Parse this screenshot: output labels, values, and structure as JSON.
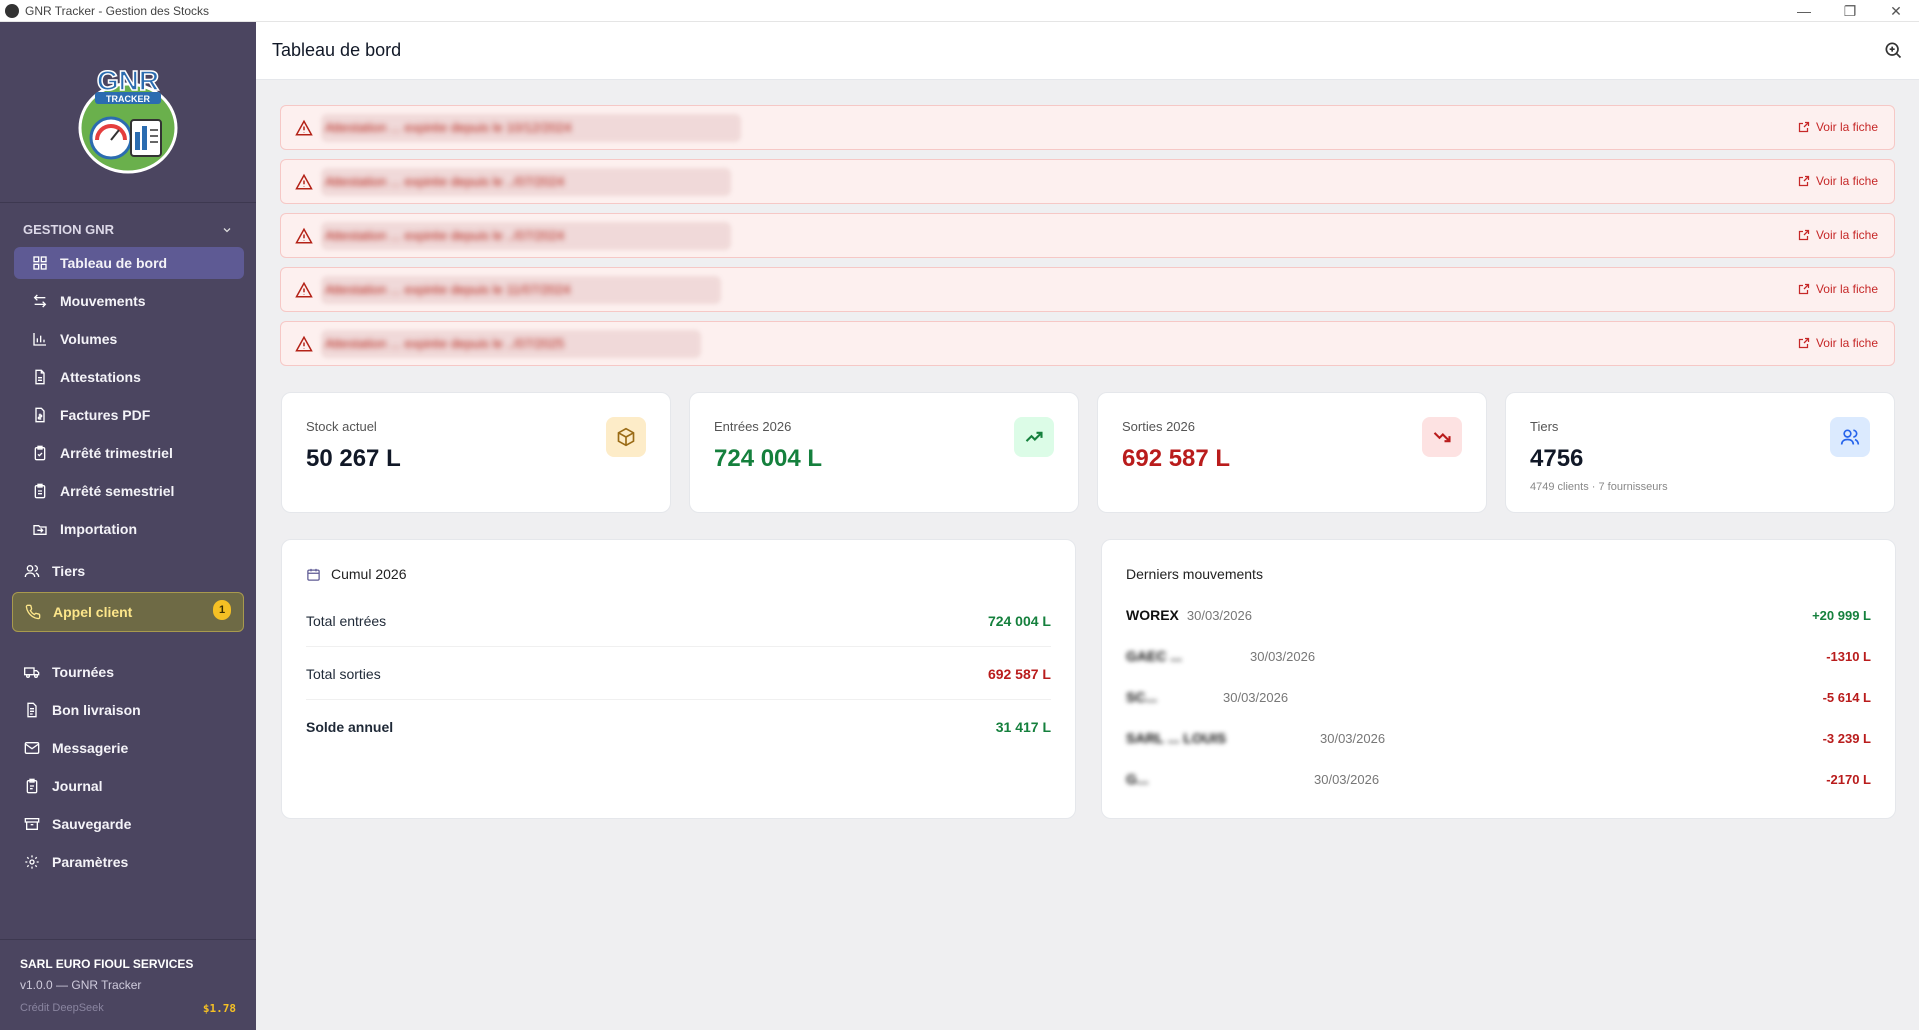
{
  "window": {
    "title": "GNR Tracker - Gestion des Stocks"
  },
  "header": {
    "title": "Tableau de bord"
  },
  "sidebar": {
    "section": "GESTION GNR",
    "items": [
      {
        "label": "Tableau de bord"
      },
      {
        "label": "Mouvements"
      },
      {
        "label": "Volumes"
      },
      {
        "label": "Attestations"
      },
      {
        "label": "Factures PDF"
      },
      {
        "label": "Arrêté trimestriel"
      },
      {
        "label": "Arrêté semestriel"
      },
      {
        "label": "Importation"
      }
    ],
    "top_items": [
      {
        "label": "Tiers"
      },
      {
        "label": "Appel client",
        "badge": "1"
      },
      {
        "label": "Tournées"
      },
      {
        "label": "Bon livraison"
      },
      {
        "label": "Messagerie"
      },
      {
        "label": "Journal"
      },
      {
        "label": "Sauvegarde"
      },
      {
        "label": "Paramètres"
      }
    ],
    "footer": {
      "company": "SARL EURO FIOUL SERVICES",
      "version": "v1.0.0 — GNR Tracker",
      "credit_label": "Crédit DeepSeek",
      "credit_amount": "$1.78"
    }
  },
  "alerts": [
    {
      "text": "Attestation ... expirée depuis le 10/12/2024",
      "link": "Voir la fiche"
    },
    {
      "text": "Attestation ... expirée depuis le ../07/2024",
      "link": "Voir la fiche"
    },
    {
      "text": "Attestation ... expirée depuis le ../07/2024",
      "link": "Voir la fiche"
    },
    {
      "text": "Attestation ... expirée depuis le 11/07/2024",
      "link": "Voir la fiche"
    },
    {
      "text": "Attestation ... expirée depuis le ../07/2025",
      "link": "Voir la fiche"
    }
  ],
  "stats": [
    {
      "label": "Stock actuel",
      "value": "50 267 L",
      "color": "#111827",
      "icon": "box-icon"
    },
    {
      "label": "Entrées 2026",
      "value": "724 004 L",
      "color": "#15803d",
      "icon": "trending-up-icon"
    },
    {
      "label": "Sorties 2026",
      "value": "692 587 L",
      "color": "#b91c1c",
      "icon": "trending-down-icon"
    },
    {
      "label": "Tiers",
      "value": "4756",
      "sub": "4749 clients · 7 fournisseurs",
      "color": "#111827",
      "icon": "users-icon"
    }
  ],
  "cumul": {
    "title": "Cumul 2026",
    "rows": [
      {
        "label": "Total entrées",
        "value": "724 004 L"
      },
      {
        "label": "Total sorties",
        "value": "692 587 L"
      },
      {
        "label": "Solde annuel",
        "value": "31 417 L"
      }
    ]
  },
  "movements": {
    "title": "Derniers mouvements",
    "rows": [
      {
        "name": "WOREX",
        "date": "30/03/2026",
        "qty": "+20 999 L"
      },
      {
        "name": "GAEC ... ",
        "date": "30/03/2026",
        "qty": "-1310 L"
      },
      {
        "name": "SC...",
        "date": "30/03/2026",
        "qty": "-5 614 L"
      },
      {
        "name": "SARL ... LOUIS",
        "date": "30/03/2026",
        "qty": "-3 239 L"
      },
      {
        "name": "G... ",
        "date": "30/03/2026",
        "qty": "-2170 L"
      }
    ]
  }
}
